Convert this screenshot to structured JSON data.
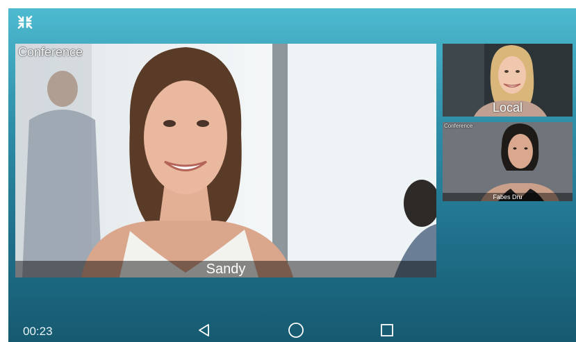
{
  "call": {
    "timer": "00:23",
    "main": {
      "mode_label": "Conference",
      "participant_name": "Sandy"
    },
    "local": {
      "label": "Local"
    },
    "remote": {
      "mode_label": "Conference",
      "participant_name": "Fabes Dru"
    }
  },
  "icons": {
    "exit_fullscreen": "exit-fullscreen-icon",
    "back": "back-triangle-icon",
    "home": "home-circle-icon",
    "recents": "recents-square-icon"
  },
  "colors": {
    "screen_top": "#4dbad0",
    "screen_bottom": "#165a70",
    "text": "#ffffff"
  }
}
